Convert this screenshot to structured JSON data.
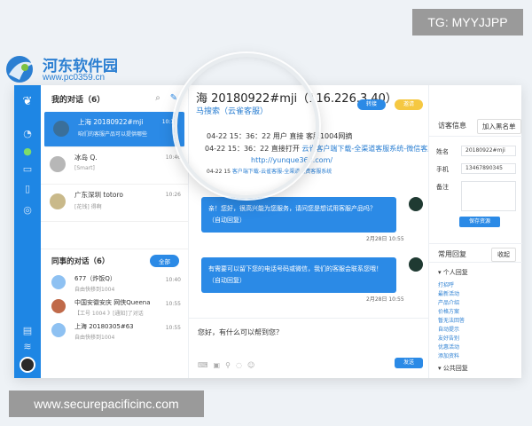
{
  "watermark_top": "TG: MYYJJPP",
  "watermark_bottom": "www.securepacificinc.com",
  "logo": {
    "name": "河东软件园",
    "url": "www.pc0359.cn"
  },
  "my_conversations": {
    "title": "我的对话（6）",
    "items": [
      {
        "name": "上海 20180922#mji",
        "sub": "咱们的客服产品可以提供哪些",
        "time": "10:11"
      },
      {
        "name": "冰岛 Q.",
        "sub": "[Smart]",
        "time": "10:46"
      },
      {
        "name": "广东深圳 totoro",
        "sub": "[花钱] 得啊",
        "time": "10:26"
      }
    ]
  },
  "colleague_conversations": {
    "title": "同事的对话（6）",
    "all_label": "全部",
    "items": [
      {
        "name": "677（炸饭Q）",
        "sub": "自由快移到1004",
        "time": "10:40"
      },
      {
        "name": "中国安徽安庆 网侠Queena",
        "sub": "【工号 1004 》[通知]了对话",
        "time": "10:55"
      },
      {
        "name": "上海 20180305#63",
        "sub": "自由快移到1004",
        "time": "10:55"
      }
    ]
  },
  "chat": {
    "title": "海 20180922#mji（116.226.3.40）",
    "subtitle": "马搜索（云雀客服）",
    "transfer_label": "转接",
    "invite_label": "邀请",
    "system_lines": [
      {
        "text": "04-22 15：36：22 用户",
        "suffix": "直接 客服1004网摘"
      },
      {
        "text": "04-22 15：36：22 直接打开",
        "suffix": "云雀客户端下载-全渠道客服系统-微信客服/微博客"
      },
      {
        "text": "http://",
        "suffix": "yunque360.com/"
      },
      {
        "text": "04-22 15",
        "suffix": "客户端下载-云雀客服-全渠道免费客服系统"
      }
    ],
    "messages": [
      {
        "text": "亲！您好，很高兴能为您服务，请问您是想试用客服产品吗？",
        "auto": "（自动回复）",
        "time": "2月28日 10:55"
      },
      {
        "text": "有需要可以留下您的电话号码或微信，我们的客服会联系您哦！",
        "auto": "（自动回复）",
        "time": "2月28日 10:55"
      }
    ],
    "composer_text": "您好，有什么可以帮到您？",
    "send_label": "发送"
  },
  "visitor": {
    "title": "访客信息",
    "blacklist_label": "加入黑名单",
    "fields": [
      {
        "label": "姓名",
        "value": "20180922#mji"
      },
      {
        "label": "手机",
        "value": "13467890345"
      },
      {
        "label": "备注",
        "value": ""
      }
    ],
    "save_label": "保存资源"
  },
  "quick_reply": {
    "title": "常用回复",
    "collapse_label": "收起",
    "personal_group": "个人回复",
    "items": [
      "打招呼",
      "最新活动",
      "产品介绍",
      "价格方案",
      "暂无法回答",
      "自动提示",
      "友好告别",
      "优惠活动",
      "添加资料"
    ],
    "public_group": "公共回复"
  },
  "colors": {
    "accent": "#2b8ae6",
    "rail": "#1e86e4",
    "link": "#2b7fd2"
  }
}
